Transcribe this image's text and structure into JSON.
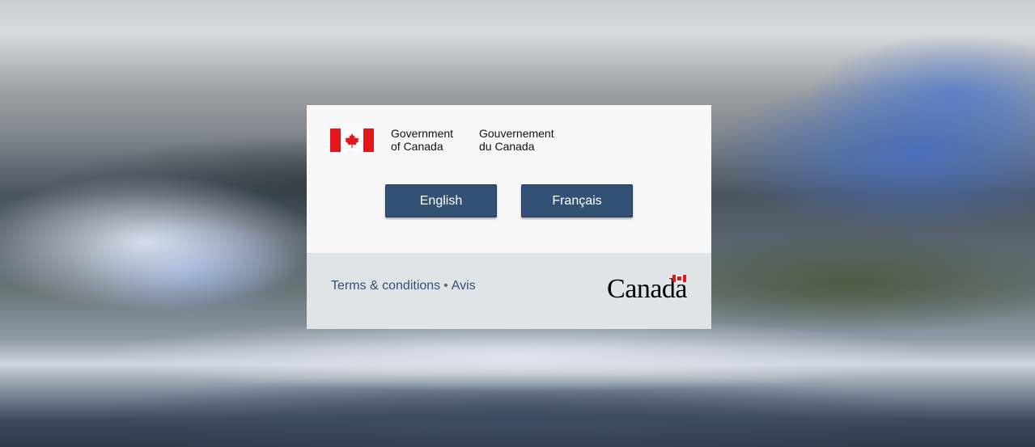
{
  "signature": {
    "en_line1": "Government",
    "en_line2": "of Canada",
    "fr_line1": "Gouvernement",
    "fr_line2": "du Canada",
    "flag_icon": "canada-flag-icon"
  },
  "buttons": {
    "english": "English",
    "french": "Français"
  },
  "footer": {
    "terms_label": "Terms & conditions",
    "separator": "•",
    "avis_label": "Avis",
    "wordmark": "Canada"
  },
  "colors": {
    "button_bg": "#335075",
    "footer_bg": "#e1e4e7",
    "flag_red": "#e4161b"
  }
}
